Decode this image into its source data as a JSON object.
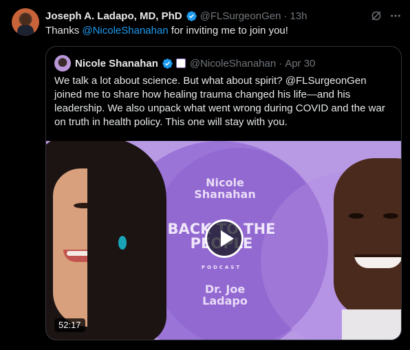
{
  "tweet": {
    "author_name": "Joseph A. Ladapo, MD, PhD",
    "handle": "@FLSurgeonGen",
    "separator": "·",
    "time": "13h",
    "text_prefix": "Thanks ",
    "mention": "@NicoleShanahan",
    "text_suffix": " for inviting me to join you!"
  },
  "quoted": {
    "author_name": "Nicole Shanahan",
    "handle": "@NicoleShanahan",
    "separator": "·",
    "date": "Apr 30",
    "text": "We talk a lot about science. But what about spirit? @FLSurgeonGen joined me to share how healing trauma changed his life—and his leadership. We also unpack what went wrong during COVID and the war on truth in health policy. This one will stay with you.",
    "media": {
      "host_line1": "Nicole",
      "host_line2": "Shanahan",
      "logo_line1": "BACK TO THE",
      "logo_line2": "PEOPLE",
      "logo_sub": "PODCAST",
      "guest_line1": "Dr. Joe",
      "guest_line2": "Ladapo",
      "duration": "52:17"
    }
  },
  "icons": {
    "verified": "verified-badge-icon",
    "grok": "grok-icon",
    "more": "more-options-icon",
    "play": "play-icon"
  },
  "colors": {
    "background": "#000000",
    "text": "#e7e9ea",
    "secondary": "#71767b",
    "link": "#1d9bf0",
    "verified": "#1d9bf0",
    "border": "#2f3336"
  }
}
